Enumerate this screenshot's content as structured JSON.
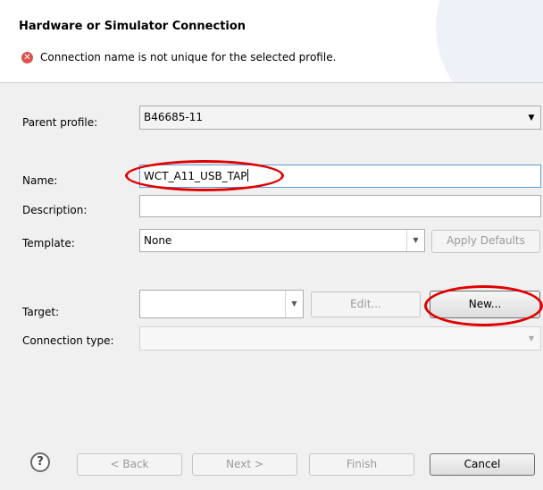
{
  "wizard": {
    "title": "Hardware or Simulator Connection",
    "error_message": "Connection name is not unique for the selected profile.",
    "error_icon": "error-icon"
  },
  "form": {
    "parent_profile": {
      "label": "Parent profile:",
      "value": "B46685-11"
    },
    "name": {
      "label": "Name:",
      "value": "WCT_A11_USB_TAP"
    },
    "description": {
      "label": "Description:",
      "value": ""
    },
    "template": {
      "label": "Template:",
      "value": "None",
      "apply_defaults_label": "Apply Defaults"
    },
    "target": {
      "label": "Target:",
      "value": "",
      "edit_label": "Edit...",
      "new_label": "New..."
    },
    "connection_type": {
      "label": "Connection type:",
      "value": ""
    }
  },
  "footer": {
    "help_glyph": "?",
    "back_label": "< Back",
    "next_label": "Next >",
    "finish_label": "Finish",
    "cancel_label": "Cancel"
  },
  "colors": {
    "annotation_red": "#e00000",
    "error_red": "#d9534f"
  }
}
